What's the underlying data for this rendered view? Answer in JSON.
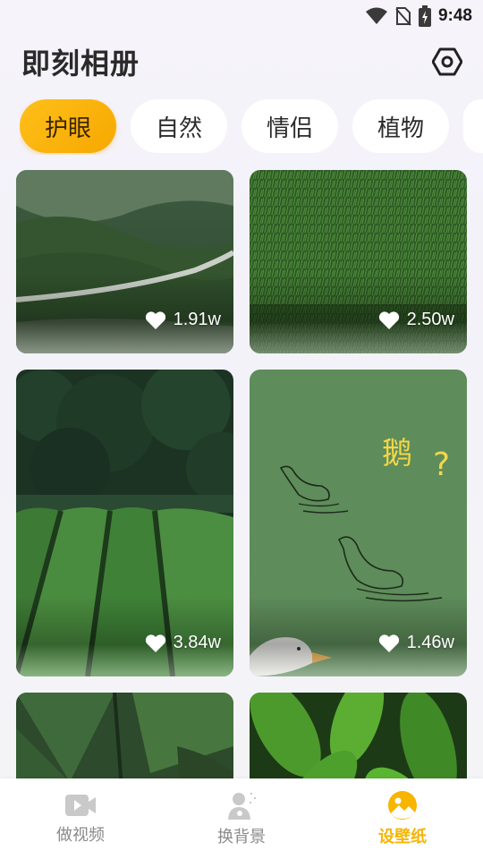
{
  "status_bar": {
    "time": "9:48"
  },
  "header": {
    "title": "即刻相册",
    "settings_icon": "gear-icon"
  },
  "categories": [
    {
      "label": "护眼",
      "active": true
    },
    {
      "label": "自然",
      "active": false
    },
    {
      "label": "情侣",
      "active": false
    },
    {
      "label": "植物",
      "active": false
    }
  ],
  "wallpapers": [
    {
      "scene": "green-hills-road",
      "likes": "1.91w"
    },
    {
      "scene": "grass-field",
      "likes": "2.50w"
    },
    {
      "scene": "tea-plantation",
      "likes": "3.84w"
    },
    {
      "scene": "goose-doodle",
      "likes": "1.46w",
      "doodle_text": "鹅",
      "doodle_mark": "?"
    },
    {
      "scene": "monstera-leaf",
      "likes": ""
    },
    {
      "scene": "jungle-leaves",
      "likes": ""
    }
  ],
  "bottom_nav": [
    {
      "label": "做视频",
      "icon": "video-camera-icon",
      "active": false
    },
    {
      "label": "换背景",
      "icon": "person-background-icon",
      "active": false
    },
    {
      "label": "设壁纸",
      "icon": "wallpaper-icon",
      "active": true
    }
  ],
  "colors": {
    "accent": "#f7b500",
    "chip_active": "#ffbf1a",
    "nav_inactive": "#8a8a8a"
  }
}
